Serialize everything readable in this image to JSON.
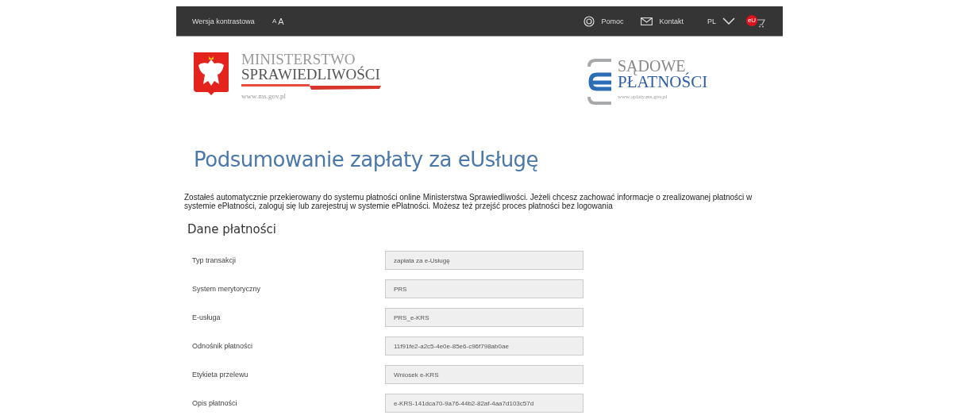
{
  "top_bar": {
    "contrast_link": "Wersja kontrastowa",
    "font_small": "A",
    "font_large": "A",
    "help": "Pomoc",
    "contact": "Kontakt",
    "language": "PL",
    "cart_badge": "eU"
  },
  "logos": {
    "ministry": {
      "line1": "MINISTERSTWO",
      "line2": "SPRAWIEDLIWOŚCI",
      "url": "www.ms.gov.pl"
    },
    "payments": {
      "line1": "SĄDOWE",
      "line2": "PŁATNOŚCI",
      "url": "www.oplaty.ms.gov.pl"
    }
  },
  "title": "Podsumowanie zapłaty za eUsługę",
  "intro": "Zostałeś automatycznie przekierowany do systemu płatności online Ministerstwa Sprawiedliwości. Jeżeli chcesz zachować informacje o zrealizowanej płatności w systemie ePłatności, zaloguj się lub zarejestruj w systemie ePłatności. Możesz też przejść proces płatności bez logowania",
  "section_title": "Dane płatności",
  "fields": [
    {
      "label": "Typ transakcji",
      "value": "zapłata za e-Usługę"
    },
    {
      "label": "System merytoryczny",
      "value": "PRS"
    },
    {
      "label": "E-usługa",
      "value": "PRS_e-KRS"
    },
    {
      "label": "Odnośnik płatności",
      "value": "11f91fe2-a2c5-4e0e-85e6-c96f798ab0ae"
    },
    {
      "label": "Etykieta przelewu",
      "value": "Wniosek e-KRS"
    },
    {
      "label": "Opis płatności",
      "value": "e-KRS-141dca70-9a76-44b2-82af-4aa7d103c57d"
    }
  ]
}
